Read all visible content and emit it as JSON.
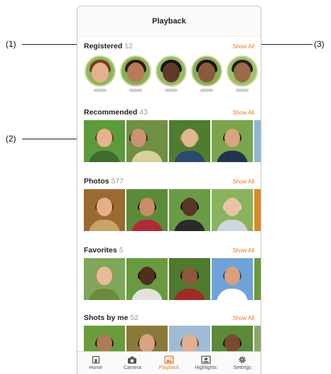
{
  "callouts": {
    "c1": "(1)",
    "c2": "(2)",
    "c3": "(3)"
  },
  "header": {
    "title": "Playback"
  },
  "sections": {
    "registered": {
      "title": "Registered",
      "count": "12",
      "show_all": "Show All"
    },
    "recommended": {
      "title": "Recommended",
      "count": "43",
      "show_all": "Show All"
    },
    "photos": {
      "title": "Photos",
      "count": "577",
      "show_all": "Show All"
    },
    "favorites": {
      "title": "Favorites",
      "count": "5",
      "show_all": "Show All"
    },
    "shots": {
      "title": "Shots by me",
      "count": "52",
      "show_all": "Show All"
    }
  },
  "tabs": [
    {
      "label": "Home",
      "icon": "home-icon"
    },
    {
      "label": "Camera",
      "icon": "camera-icon"
    },
    {
      "label": "Playback",
      "icon": "playback-icon"
    },
    {
      "label": "Highlights",
      "icon": "highlights-icon"
    },
    {
      "label": "Settings",
      "icon": "gear-icon"
    }
  ],
  "colors": {
    "accent": "#e8792b",
    "count": "#999999",
    "text": "#222222"
  }
}
